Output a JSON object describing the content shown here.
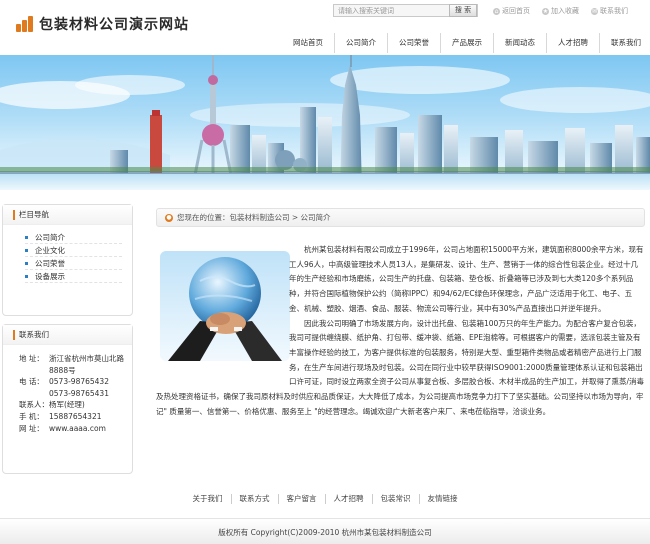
{
  "site": {
    "title": "包装材料公司演示网站"
  },
  "search": {
    "placeholder": "请输入搜索关键词",
    "button": "搜 索"
  },
  "toplinks": [
    "返回首页",
    "加入收藏",
    "联系我们"
  ],
  "nav": [
    {
      "label": "网站首页",
      "active": false
    },
    {
      "label": "公司简介",
      "active": false
    },
    {
      "label": "公司荣誉",
      "active": false
    },
    {
      "label": "产品展示",
      "active": false
    },
    {
      "label": "新闻动态",
      "active": false
    },
    {
      "label": "人才招聘",
      "active": false
    },
    {
      "label": "联系我们",
      "active": false
    }
  ],
  "sidebar": {
    "menu_title": "栏目导航",
    "menu": [
      "公司简介",
      "企业文化",
      "公司荣誉",
      "设备展示"
    ],
    "contact_title": "联系我们",
    "contact": [
      {
        "k": "地 址：",
        "v": "浙江省杭州市莫山北路8888号"
      },
      {
        "k": "电 话：",
        "v": "0573-98765432"
      },
      {
        "k": "",
        "v": "0573-98765431"
      },
      {
        "k": "联系人：",
        "v": "杨军(经理)"
      },
      {
        "k": "手 机：",
        "v": "15887654321"
      },
      {
        "k": "网 址：",
        "v": "www.aaaa.com"
      }
    ]
  },
  "breadcrumb": "您现在的位置：包装材料制造公司 > 公司简介",
  "article": {
    "p1": "杭州某包装材料有限公司成立于1996年，公司占地面积15000平方米，建筑面积8000余平方米，现有工人96人，中高级管理技术人员13人，是集研发、设计、生产、营销于一体的综合性包装企业。经过十几年的生产经验和市场磨练，公司生产的托盘、包装箱、垫仓板、折叠箱等已涉及到七大类120多个系列品种，并符合国际植物保护公约（简称IPPC）和94/62/EC绿色环保理念，产品广泛适用于化工、电子、五金、机械、塑胶、烟酒、食品、服装、物流公司等行业，其中有30%产品直接出口并逆年提升。",
    "p2": "因此我公司明确了市场发展方向，设计出托盘、包装箱100万只的年生产能力。为配合客户复合包装，我司可提供缠绕膜、纸护角、打包带、缓冲袋、纸箱、EPE泡棉等。可根据客户的需要，选派包装主管及有丰富操作经验的技工，为客户提供标准的包装服务，特别是大型、重型箱件类物品或者精密产品进行上门服务，在生产车间进行现场及时包装。公司在同行业中较早获得ISO9001:2000质量管理体系认证和包装箱出口许可证，同时设立两家全资子公司从事复合板、多层胶合板、木材半成品的生产加工，并取得了熏蒸/消毒及热处理资格证书，确保了我司原材料及时供应和品质保证，大大降低了成本，为公司提高市场竞争力打下了坚实基础。公司坚持以市场为导向，牢记\" 质量第一、信誉第一、价格优惠、服务至上 \"的经营理念。竭诚欢迎广大新老客户来厂、来电莅临指导，洽谈业务。"
  },
  "footer": {
    "links": [
      "关于我们",
      "联系方式",
      "客户留言",
      "人才招聘",
      "包装常识",
      "友情链接"
    ],
    "copyright": "版权所有  Copyright(C)2009-2010 杭州市某包装材料制造公司"
  },
  "colors": {
    "accent": "#e07a1f",
    "link_blue": "#2c7fc4",
    "sky": "#7ec7f2"
  }
}
